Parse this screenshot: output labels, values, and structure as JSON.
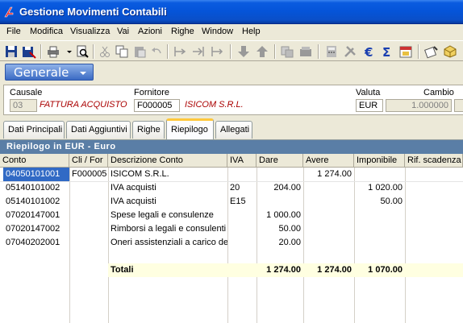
{
  "window": {
    "title": "Gestione Movimenti Contabili"
  },
  "menu": [
    "File",
    "Modifica",
    "Visualizza",
    "Vai",
    "Azioni",
    "Righe",
    "Window",
    "Help"
  ],
  "section": {
    "label": "Generale"
  },
  "header": {
    "causale_label": "Causale",
    "causale_code": "03",
    "causale_desc": "FATTURA ACQUISTO",
    "fornitore_label": "Fornitore",
    "fornitore_code": "F000005",
    "fornitore_name": "ISICOM S.R.L.",
    "valuta_label": "Valuta",
    "valuta_value": "EUR",
    "cambio_label": "Cambio",
    "cambio_value": "1.000000"
  },
  "tabs": [
    "Dati Principali",
    "Dati Aggiuntivi",
    "Righe",
    "Riepilogo",
    "Allegati"
  ],
  "active_tab": "Riepilogo",
  "grid": {
    "title": "Riepilogo in EUR - Euro",
    "columns": [
      "Conto",
      "Cli / For",
      "Descrizione Conto",
      "IVA",
      "Dare",
      "Avere",
      "Imponibile",
      "Rif. scadenza"
    ],
    "rows": [
      {
        "conto": "04050101001",
        "clifor": "F000005",
        "descr": "ISICOM S.R.L.",
        "iva": "",
        "dare": "",
        "avere": "1 274.00",
        "imponibile": ""
      },
      {
        "conto": "05140101002",
        "clifor": "",
        "descr": "IVA acquisti",
        "iva": "20",
        "dare": "204.00",
        "avere": "",
        "imponibile": "1 020.00"
      },
      {
        "conto": "05140101002",
        "clifor": "",
        "descr": "IVA acquisti",
        "iva": "E15",
        "dare": "",
        "avere": "",
        "imponibile": "50.00"
      },
      {
        "conto": "07020147001",
        "clifor": "",
        "descr": "Spese legali e consulenze",
        "iva": "",
        "dare": "1 000.00",
        "avere": "",
        "imponibile": ""
      },
      {
        "conto": "07020147002",
        "clifor": "",
        "descr": "Rimborsi a legali e consulenti",
        "iva": "",
        "dare": "50.00",
        "avere": "",
        "imponibile": ""
      },
      {
        "conto": "07040202001",
        "clifor": "",
        "descr": "Oneri assistenziali a carico de",
        "iva": "",
        "dare": "20.00",
        "avere": "",
        "imponibile": ""
      }
    ],
    "totals": {
      "label": "Totali",
      "dare": "1 274.00",
      "avere": "1 274.00",
      "imponibile": "1 070.00"
    }
  },
  "colors": {
    "title_bar": "#0554d8",
    "grid_title": "#5a7ea6",
    "selection": "#316ac5",
    "total_row": "#ffffe1",
    "tab_accent": "#ffc83c"
  }
}
